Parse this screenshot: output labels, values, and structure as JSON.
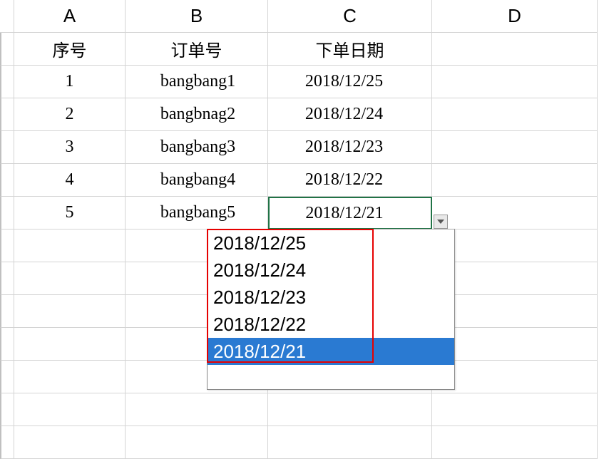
{
  "columns": [
    "A",
    "B",
    "C",
    "D"
  ],
  "headers": {
    "a": "序号",
    "b": "订单号",
    "c": "下单日期"
  },
  "rows": [
    {
      "num": "1",
      "order": "bangbang1",
      "date": "2018/12/25"
    },
    {
      "num": "2",
      "order": "bangbnag2",
      "date": "2018/12/24"
    },
    {
      "num": "3",
      "order": "bangbang3",
      "date": "2018/12/23"
    },
    {
      "num": "4",
      "order": "bangbang4",
      "date": "2018/12/22"
    },
    {
      "num": "5",
      "order": "bangbang5",
      "date": "2018/12/21"
    }
  ],
  "dropdown": {
    "items": [
      "2018/12/25",
      "2018/12/24",
      "2018/12/23",
      "2018/12/22",
      "2018/12/21"
    ],
    "selected_index": 4
  },
  "selected_cell": "C6"
}
